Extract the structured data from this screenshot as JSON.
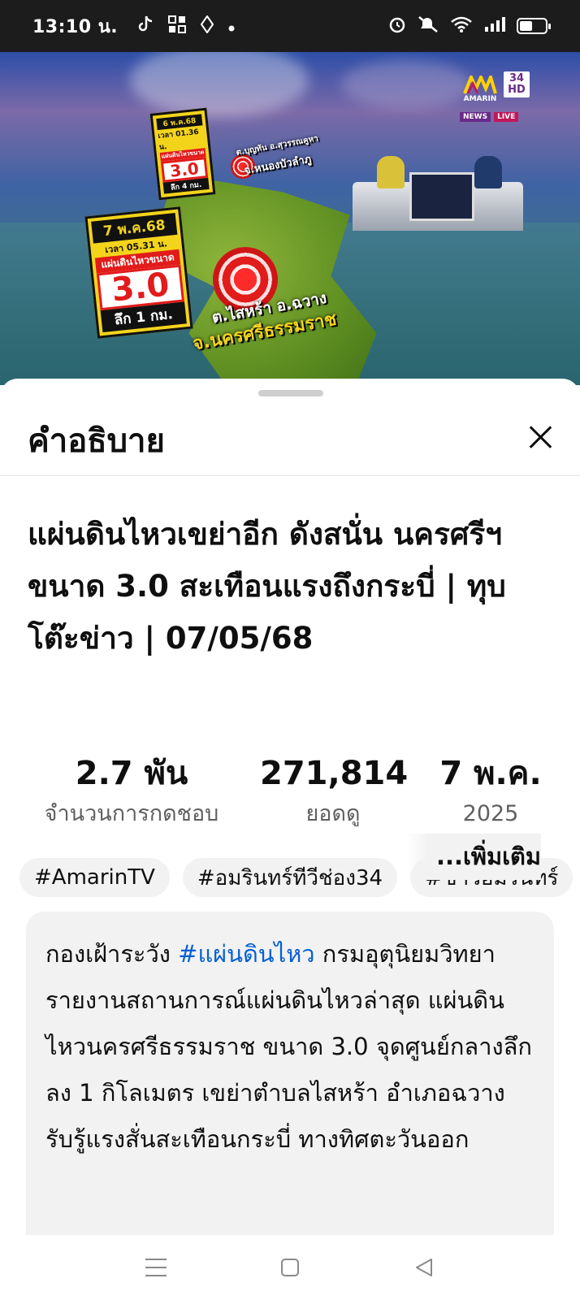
{
  "status_bar": {
    "time": "13:10 น.",
    "notification_icons": [
      "tiktok-icon",
      "app-grid-icon",
      "location-arrow-icon",
      "dot-icon"
    ],
    "system_icons": [
      "alarm-icon",
      "mute-icon",
      "wifi-icon",
      "signal-icon",
      "battery-icon"
    ],
    "battery_level": 0.5
  },
  "video": {
    "channel_logo": {
      "number": "34",
      "quality": "HD",
      "brand": "AMARIN",
      "tags": [
        "NEWS",
        "LIVE"
      ]
    },
    "card_top": {
      "date": "6 พ.ค.68",
      "time": "เวลา 01.36 น.",
      "label": "แผ่นดินไหวขนาด",
      "magnitude": "3.0",
      "depth": "ลึก 4 กม."
    },
    "card_main": {
      "date": "7 พ.ค.68",
      "time": "เวลา 05.31 น.",
      "label": "แผ่นดินไหวขนาด",
      "magnitude": "3.0",
      "depth": "ลึก 1 กม."
    },
    "label_north_district": "ต.บุญทัน อ.สุวรรณคูหา",
    "label_north_province": "จ.หนองบัวลำภู",
    "label_south_district": "ต.ไสหร้า อ.ฉวาง",
    "label_south_province": "จ.นครศรีธรรมราช"
  },
  "sheet": {
    "title": "คำอธิบาย",
    "video_title": "แผ่นดินไหวเขย่าอีก ดังสนั่น นครศรีฯ ขนาด 3.0 สะเทือนแรงถึงกระบี่ | ทุบโต๊ะข่าว | 07/05/68",
    "stats": [
      {
        "value": "2.7 พัน",
        "label": "จำนวนการกดชอบ"
      },
      {
        "value": "271,814",
        "label": "ยอดดู"
      },
      {
        "value": "7 พ.ค.",
        "label": "2025"
      }
    ],
    "hashtags": [
      "#AmarinTV",
      "#อมรินทร์ทีวีช่อง34",
      "#ข่าวอมรินทร์"
    ],
    "description": {
      "prefix": "กองเฝ้าระวัง ",
      "hashtag": "#แผ่นดินไหว",
      "body": " กรมอุตุนิยมวิทยา รายงานสถานการณ์แผ่นดินไหวล่าสุด แผ่นดินไหวนครศรีธรรมราช ขนาด 3.0 จุดศูนย์กลางลึกลง 1 กิโลเมตร เขย่าตำบลไสหร้า อำเภอฉวาง รับรู้แรงสั่นสะเทือนกระบี่ ทางทิศตะวันออก"
    },
    "more_label": "...เพิ่มเติม"
  },
  "nav_bar": {
    "buttons": [
      "menu-icon",
      "home-icon",
      "back-icon"
    ]
  }
}
